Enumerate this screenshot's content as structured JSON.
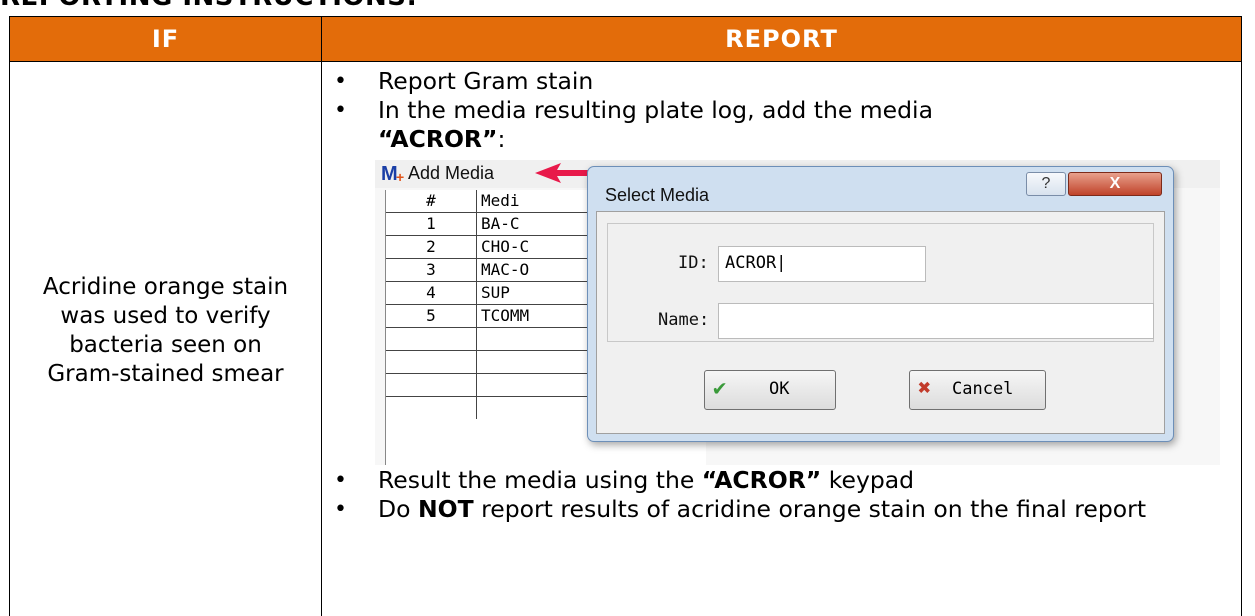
{
  "heading": "REPORTING INSTRUCTIONS:",
  "table": {
    "header_if": "IF",
    "header_report": "REPORT",
    "condition": "Acridine orange stain was used to verify bacteria seen on Gram-stained smear"
  },
  "steps_top": [
    {
      "text": "Report Gram stain"
    },
    {
      "text_before": "In the media resulting plate log, add the media ",
      "bold": "“ACROR”",
      "text_after": ":"
    }
  ],
  "steps_bottom": [
    {
      "text_before": "Result the media using the ",
      "bold": "“ACROR”",
      "text_after": " keypad"
    },
    {
      "text_before": "Do ",
      "bold": "NOT",
      "text_after": " report results of acridine orange stain on the final report"
    }
  ],
  "screenshot": {
    "toolbar_label": "Add Media",
    "grid_header": {
      "num": "#",
      "name": "Medi"
    },
    "rows": [
      {
        "num": "1",
        "name": "BA-C"
      },
      {
        "num": "2",
        "name": "CHO-C"
      },
      {
        "num": "3",
        "name": "MAC-O"
      },
      {
        "num": "4",
        "name": "SUP"
      },
      {
        "num": "5",
        "name": "TCOMM"
      }
    ],
    "dialog": {
      "title": "Select Media",
      "help": "?",
      "close": "X",
      "id_label": "ID:",
      "id_value": "ACROR|",
      "name_label": "Name:",
      "name_value": "",
      "ok_label": "OK",
      "cancel_label": "Cancel"
    }
  },
  "colors": {
    "header_bg": "#E36C0A",
    "header_text": "#FFFFFF",
    "arrow": "#E8194A"
  }
}
